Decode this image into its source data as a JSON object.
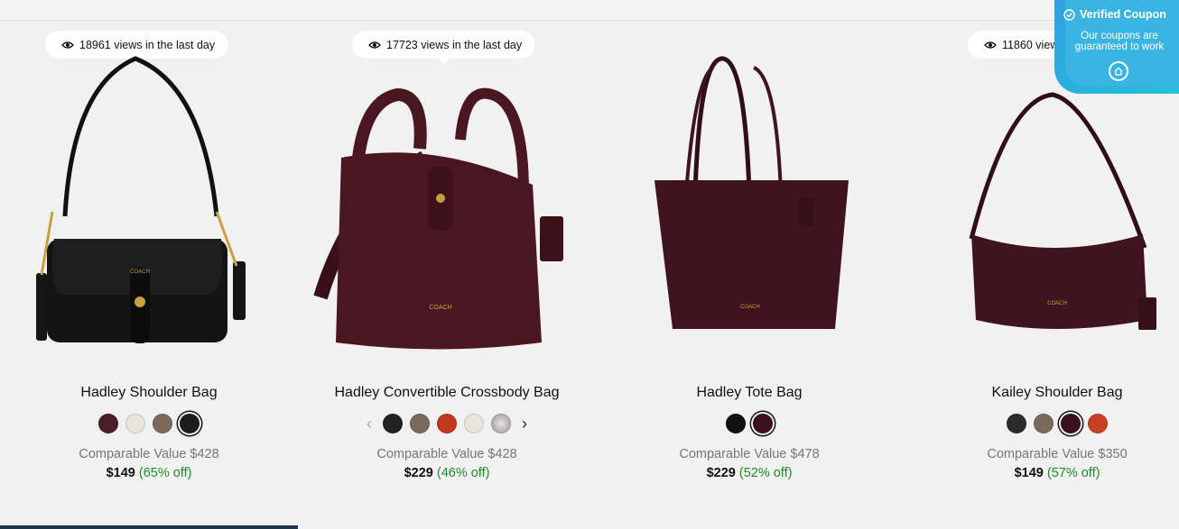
{
  "products": [
    {
      "views": "18961 views in the last day",
      "title": "Hadley Shoulder Bag",
      "comparable": "Comparable Value $428",
      "price": "$149",
      "discount": "(65% off)",
      "swatches": [
        "#4a1e28",
        "#e9e5dd",
        "#7b6a5c",
        "#1d1d1d"
      ],
      "selected_swatch": 3,
      "bag_color": "#141414"
    },
    {
      "views": "17723 views in the last day",
      "title": "Hadley Convertible Crossbody Bag",
      "comparable": "Comparable Value $428",
      "price": "$229",
      "discount": "(46% off)",
      "swatches": [
        "#222222",
        "#7b6a5c",
        "#c1391b",
        "#e9e5dd",
        "#b3aeae"
      ],
      "selected_swatch": -1,
      "bag_color": "#4a1620"
    },
    {
      "views": "",
      "title": "Hadley Tote Bag",
      "comparable": "Comparable Value $478",
      "price": "$229",
      "discount": "(52% off)",
      "swatches": [
        "#111111",
        "#3d1020"
      ],
      "selected_swatch": 1,
      "bag_color": "#3f1420"
    },
    {
      "views": "11860 views in the last day",
      "title": "Kailey Shoulder Bag",
      "comparable": "Comparable Value $350",
      "price": "$149",
      "discount": "(57% off)",
      "swatches": [
        "#2a2a2a",
        "#7b6a5c",
        "#3d1020",
        "#c7401f"
      ],
      "selected_swatch": 2,
      "bag_color": "#3f1420"
    }
  ],
  "coupon": {
    "heading": "Verified Coupon",
    "message": "Our coupons are guaranteed to work"
  },
  "icons": {
    "views": "eye-icon",
    "coupon_check": "check-circle-icon",
    "coupon_button": "chat-icon",
    "prev": "chevron-left-icon",
    "next": "chevron-right-icon"
  },
  "colors": {
    "discount": "#1f8a2a",
    "coupon_bg": "#3ab4e2"
  }
}
